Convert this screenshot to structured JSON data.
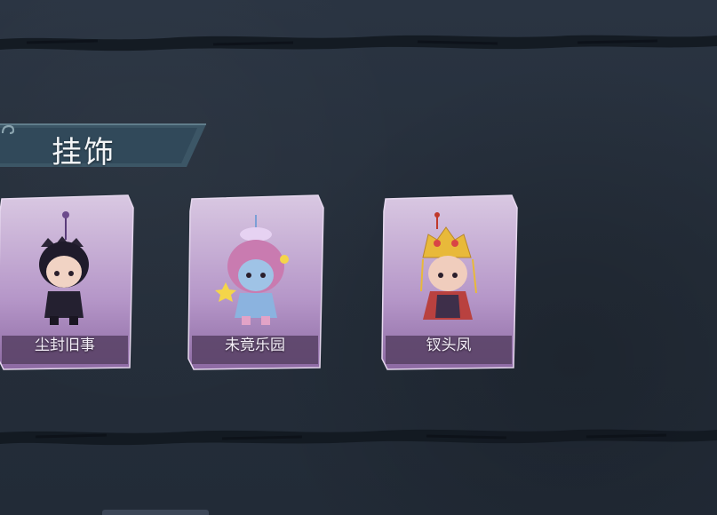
{
  "section": {
    "title": "挂饰",
    "icon_left": "swirl-ornament-icon",
    "icon_right": "swirl-ornament-icon"
  },
  "items": [
    {
      "name": "尘封旧事",
      "figure": "black-haired-chibi-with-crown-pendant"
    },
    {
      "name": "未竟乐园",
      "figure": "pink-haired-chibi-with-star-pendant"
    },
    {
      "name": "钗头凤",
      "figure": "chibi-with-golden-phoenix-crown-pendant"
    }
  ],
  "colors": {
    "background": "#26303d",
    "card_purple": "#b497c6",
    "label_bar": "#5b4468",
    "header_teal": "#3e5a6a"
  }
}
